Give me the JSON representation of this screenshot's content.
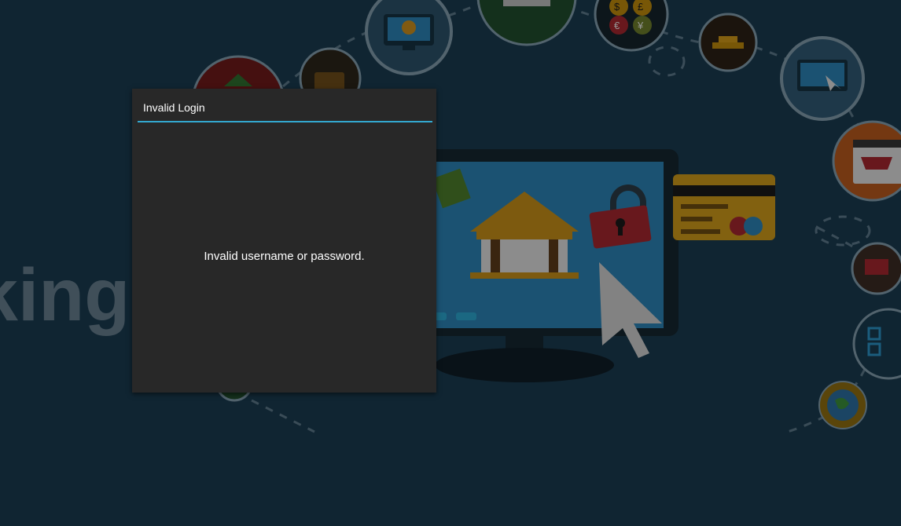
{
  "background": {
    "word_fragment": "king",
    "colors": {
      "base": "#1a3a4e",
      "circle": "#2e5a78",
      "circle_border": "#8fa6b4"
    },
    "icons": [
      "monitor-coin-icon",
      "cash-register-icon",
      "currency-coins-icon",
      "gold-bars-icon",
      "online-shopping-icon",
      "shopping-cart-icon",
      "wallet-icon",
      "money-bag-icon",
      "laptop-shop-icon",
      "qr-code-icon",
      "globe-icon",
      "bank-monitor-icon",
      "credit-card-icon"
    ],
    "currency_symbols": [
      "$",
      "£",
      "€",
      "¥"
    ]
  },
  "dialog": {
    "title": "Invalid Login",
    "message": "Invalid username or password.",
    "accent_color": "#33a8d0",
    "background_color": "#282828"
  }
}
